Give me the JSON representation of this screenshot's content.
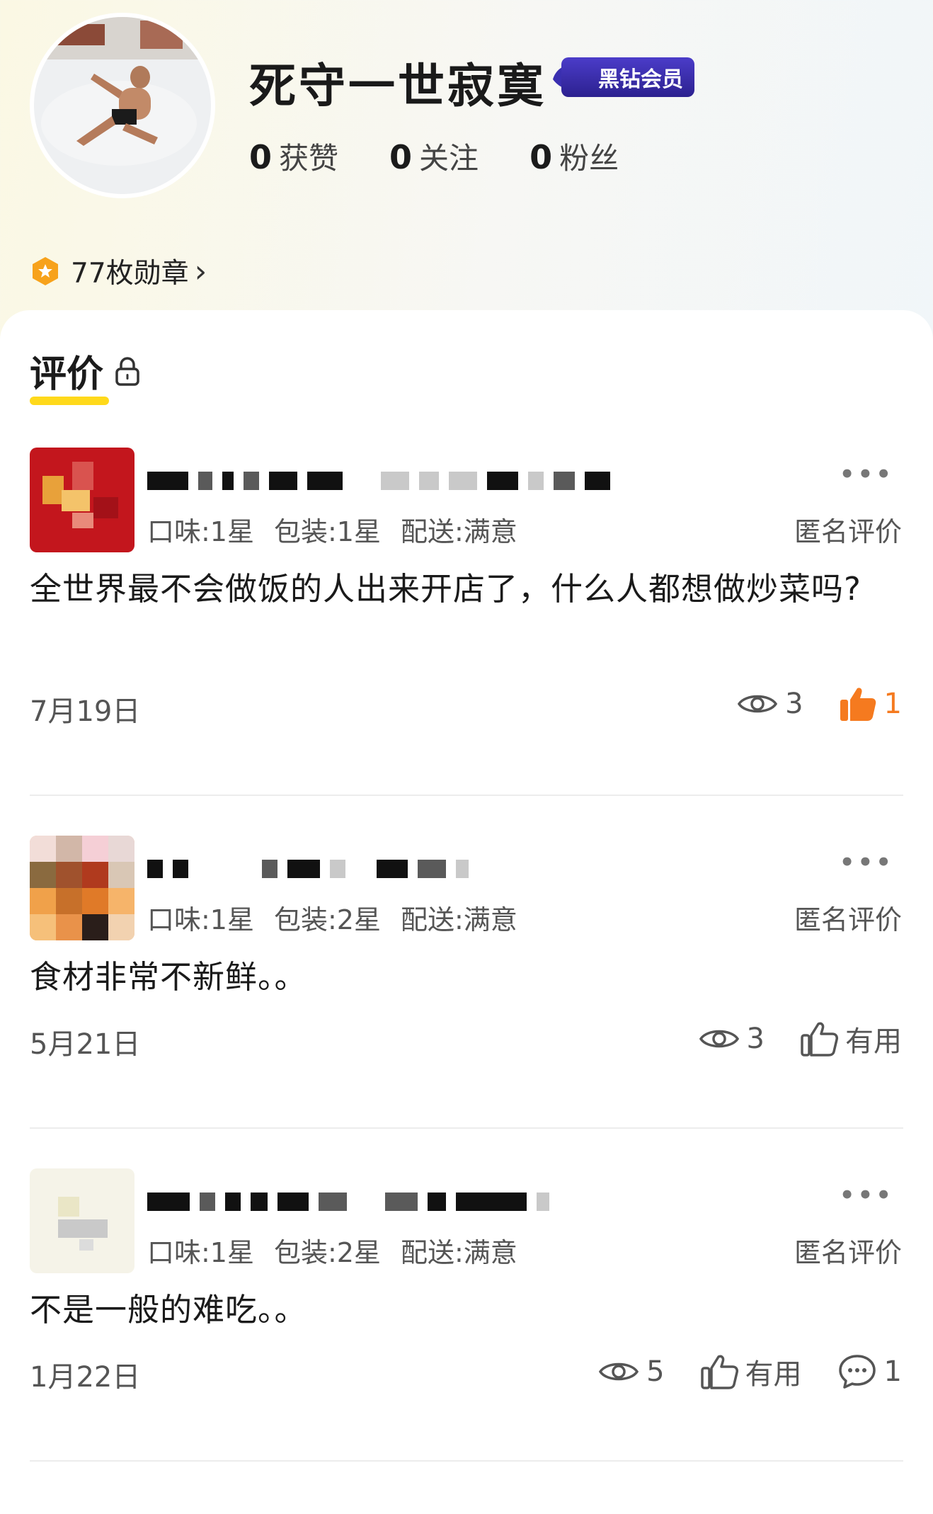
{
  "profile": {
    "name": "死守一世寂寞",
    "vip_badge": "黑钻会员",
    "stats": [
      {
        "num": "0",
        "label": "获赞"
      },
      {
        "num": "0",
        "label": "关注"
      },
      {
        "num": "0",
        "label": "粉丝"
      }
    ],
    "medal_text": "77枚勋章",
    "medal_chevron": "›"
  },
  "tab": {
    "label": "评价",
    "icon": "lock-icon"
  },
  "reviews": [
    {
      "ratings": [
        "口味:1星",
        "包装:1星",
        "配送:满意"
      ],
      "anon": "匿名评价",
      "content": "全世界最不会做饭的人出来开店了，什么人都想做炒菜吗?",
      "date": "7月19日",
      "views": "3",
      "likes": "1",
      "more": "•••"
    },
    {
      "ratings": [
        "口味:1星",
        "包装:2星",
        "配送:满意"
      ],
      "anon": "匿名评价",
      "content": "食材非常不新鲜。。",
      "date": "5月21日",
      "views": "3",
      "useful": "有用",
      "more": "•••"
    },
    {
      "ratings": [
        "口味:1星",
        "包装:2星",
        "配送:满意"
      ],
      "anon": "匿名评价",
      "content": "不是一般的难吃。。",
      "date": "1月22日",
      "views": "5",
      "useful": "有用",
      "comments": "1",
      "more": "•••"
    }
  ],
  "colors": {
    "accent_yellow": "#ffd91b",
    "like_orange": "#f57a1f",
    "vip_purple": "#3a2fb0",
    "medal_orange": "#f7a21b"
  }
}
